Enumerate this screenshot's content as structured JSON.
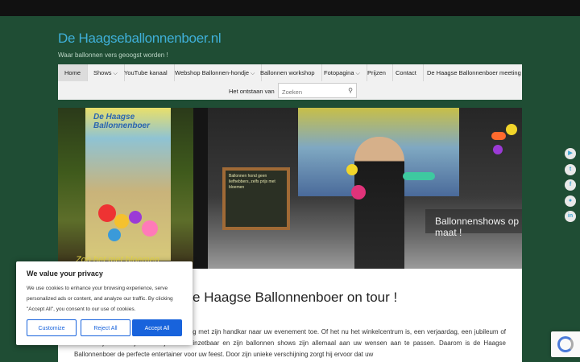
{
  "site": {
    "title": "De Haagseballonnenboer.nl",
    "tagline": "Waar ballonnen vers geoogst worden !"
  },
  "nav": {
    "items": [
      {
        "label": "Home",
        "has_dropdown": false
      },
      {
        "label": "Shows",
        "has_dropdown": true
      },
      {
        "label": "YouTube kanaal",
        "has_dropdown": false
      },
      {
        "label": "Webshop Ballonnen-hondje",
        "has_dropdown": true
      },
      {
        "label": "Ballonnen workshop",
        "has_dropdown": false
      },
      {
        "label": "Fotopagina",
        "has_dropdown": true
      },
      {
        "label": "Prijzen",
        "has_dropdown": false
      },
      {
        "label": "Contact",
        "has_dropdown": false
      },
      {
        "label": "De Haagse Ballonnenboer meeting",
        "has_dropdown": false
      },
      {
        "label": "Het ontstaan van",
        "has_dropdown": false
      }
    ],
    "search_placeholder": "Zoeken",
    "chevron": "⌵"
  },
  "hero": {
    "caption": "Ballonnenshows op maat !",
    "logo_text": "De Haagse Ballonnenboer",
    "script_text": "Zoo het met bloemen",
    "board_text": "Ballonnen hond geen liefhebbers, zelfs prijs met bloemen"
  },
  "content": {
    "heading": "De Haagse Ballonnenboer on tour !",
    "paragraph": "De Haagse Ballonnenboer” komt hij graag met zijn handkar naar uw evenement toe. Of het nu het winkelcentrum is, een verjaardag, een jubileum of een bedrijfsfeest. Hij is letterlijk overal inzetbaar en zijn ballonnen shows zijn allemaal aan uw wensen aan te passen. Daarom is de Haagse Ballonnenboer de perfecte entertainer voor uw feest. Door zijn unieke verschijning zorgt hij ervoor dat uw"
  },
  "cookie": {
    "title": "We value your privacy",
    "text": "We use cookies to enhance your browsing experience, serve personalized ads or content, and analyze our traffic. By clicking \"Accept All\", you consent to our use of cookies.",
    "customize": "Customize",
    "reject": "Reject All",
    "accept": "Accept All",
    "accent_color": "#1863dc"
  },
  "social": [
    {
      "icon": "youtube-icon",
      "glyph": "▶"
    },
    {
      "icon": "twitter-icon",
      "glyph": "t"
    },
    {
      "icon": "facebook-icon",
      "glyph": "f"
    },
    {
      "icon": "user-icon",
      "glyph": "●"
    },
    {
      "icon": "linkedin-icon",
      "glyph": "in"
    }
  ],
  "colors": {
    "background": "#1f4d34",
    "title": "#3fb0d9",
    "topbar": "#111111"
  }
}
